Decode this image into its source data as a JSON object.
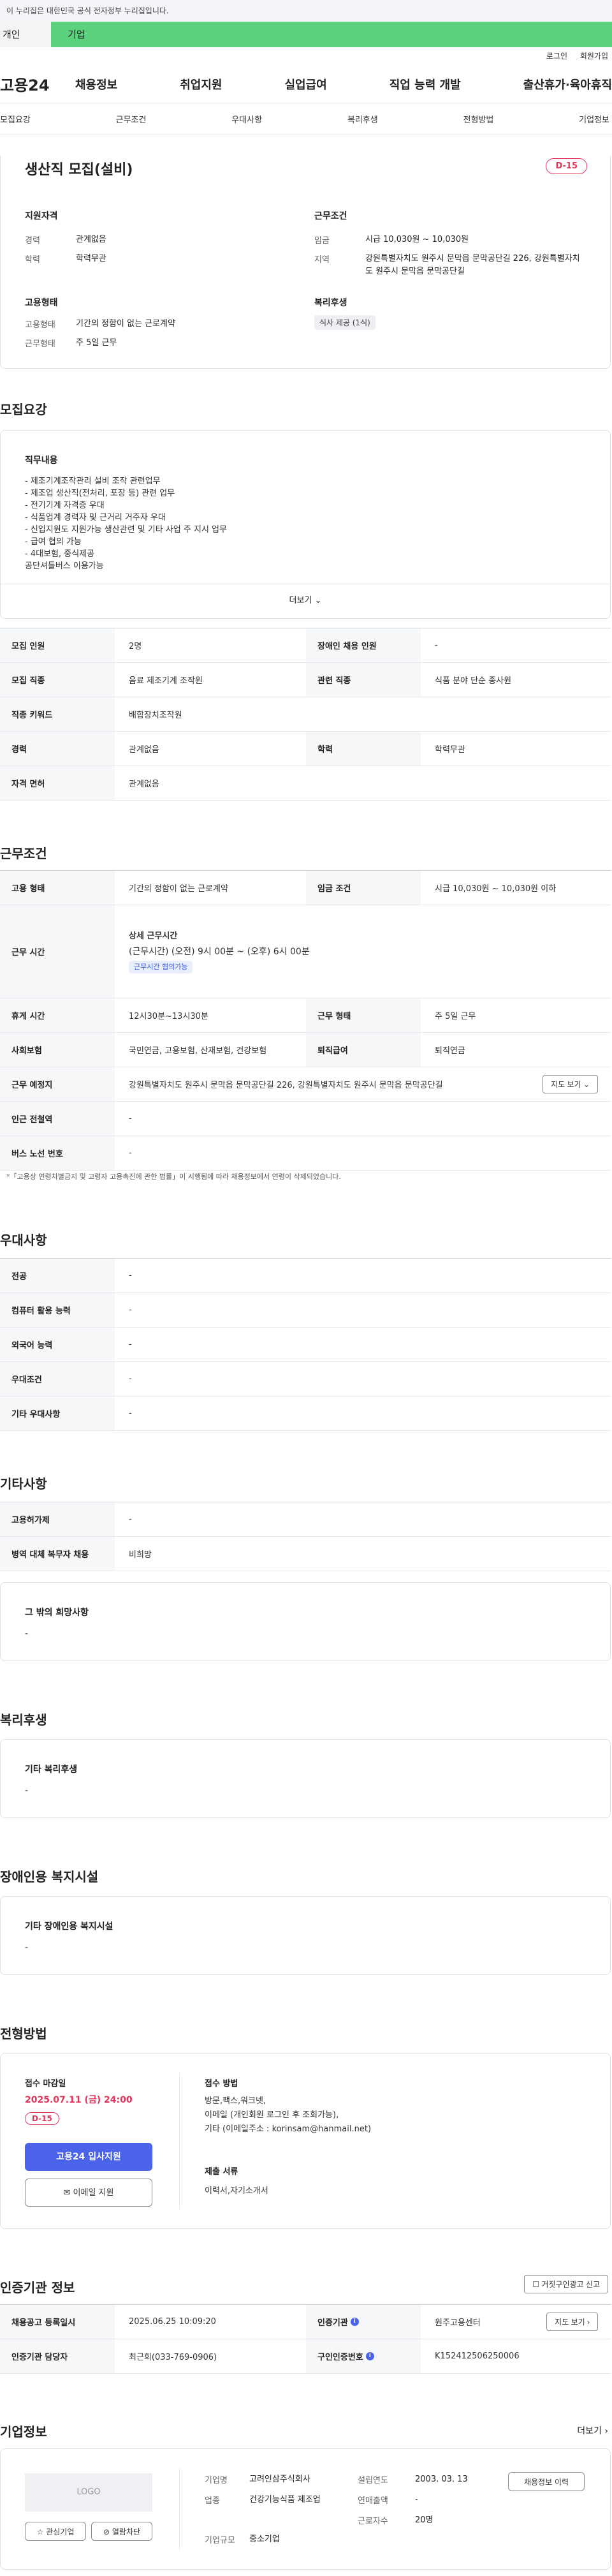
{
  "gov_banner": "이 누리집은 대한민국 공식 전자정부 누리집입니다.",
  "tabs": {
    "left": "개인",
    "right": "기업"
  },
  "util": {
    "login": "로그인",
    "join": "회원가입"
  },
  "logo": "고용24",
  "gnb": [
    "채용정보",
    "취업지원",
    "실업급여",
    "직업 능력 개발",
    "출산휴가·육아휴직"
  ],
  "anchors": [
    "모집요강",
    "근무조건",
    "우대사항",
    "복리후생",
    "전형방법",
    "기업정보"
  ],
  "job": {
    "title": "생산직 모집(설비)",
    "dday": "D-15",
    "qual_title": "지원자격",
    "qual": [
      {
        "k": "경력",
        "v": "관계없음"
      },
      {
        "k": "학력",
        "v": "학력무관"
      }
    ],
    "cond_title": "근무조건",
    "cond": [
      {
        "k": "임금",
        "v": "시급 10,030원 ~ 10,030원"
      },
      {
        "k": "지역",
        "v": "강원특별자치도 원주시 문막읍 문막공단길 226, 강원특별자치도 원주시 문막읍 문막공단길"
      }
    ],
    "emp_title": "고용형태",
    "emp": [
      {
        "k": "고용형태",
        "v": "기간의 정함이 없는 근로계약"
      },
      {
        "k": "근무형태",
        "v": "주 5일 근무"
      }
    ],
    "welfare_title": "복리후생",
    "welfare_chip": "식사 제공 (1식)"
  },
  "recruit": {
    "title": "모집요강",
    "duty_title": "직무내용",
    "duties": [
      "- 제조기계조작관리 설비 조작 관련업무",
      "- 제조업 생산직(전처리, 포장 등) 관련 업무",
      "- 전기기계 자격증 우대",
      "- 식품업계 경력자 및 근거리 거주자 우대",
      "- 신입지원도 지원가능 생산관련 및 기타 사업 주 지시 업무",
      "- 급여  협의 가능",
      "- 4대보험, 중식제공",
      "공단셔틀버스 이용가능"
    ],
    "more": "더보기",
    "rows": [
      {
        "a": "모집 인원",
        "b": "2명",
        "c": "장애인 채용 인원",
        "d": "-"
      },
      {
        "a": "모집 직종",
        "b": "음료 제조기계 조작원",
        "c": "관련 직종",
        "d": "식품 분야 단순 종사원"
      },
      {
        "a": "직종 키워드",
        "b": "배합장치조작원"
      },
      {
        "a": "경력",
        "b": "관계없음",
        "c": "학력",
        "d": "학력무관"
      },
      {
        "a": "자격 면허",
        "b": "관계없음"
      }
    ]
  },
  "work": {
    "title": "근무조건",
    "r1": {
      "a": "고용 형태",
      "b": "기간의 정함이 없는 근로계약",
      "c": "임금 조건",
      "d": "시급 10,030원 ~ 10,030원 이하"
    },
    "r2": {
      "a": "근무 시간",
      "sub": "상세 근무시간",
      "line": "(근무시간) (오전) 9시 00분 ~ (오후) 6시 00분",
      "chip": "근무시간 협의가능"
    },
    "r3": {
      "a": "휴게 시간",
      "b": "12시30분~13시30분",
      "c": "근무 형태",
      "d": "주 5일 근무"
    },
    "r4": {
      "a": "사회보험",
      "b": "국민연금, 고용보험, 산재보험, 건강보험",
      "c": "퇴직급여",
      "d": "퇴직연금"
    },
    "r5": {
      "a": "근무 예정지",
      "b": "강원특별자치도 원주시 문막읍 문막공단길 226, 강원특별자치도 원주시 문막읍 문막공단길",
      "btn": "지도 보기"
    },
    "r6": {
      "a": "인근 전철역",
      "b": "-"
    },
    "r7": {
      "a": "버스 노선 번호",
      "b": "-"
    },
    "note": "*「고용상 연령차별금지 및 고령자 고용촉진에 관한 법률」이 시행됨에 따라 채용정보에서 연령이 삭제되었습니다."
  },
  "pref": {
    "title": "우대사항",
    "rows": [
      {
        "a": "전공",
        "b": "-"
      },
      {
        "a": "컴퓨터 활용 능력",
        "b": "-"
      },
      {
        "a": "외국어 능력",
        "b": "-"
      },
      {
        "a": "우대조건",
        "b": "-"
      },
      {
        "a": "기타 우대사항",
        "b": "-"
      }
    ]
  },
  "etc": {
    "title": "기타사항",
    "rows": [
      {
        "a": "고용허가제",
        "b": "-"
      },
      {
        "a": "병역 대체 복무자 채용",
        "b": "비희망"
      }
    ],
    "box_t": "그 밖의 희망사항",
    "box_d": "-"
  },
  "welfare": {
    "title": "복리후생",
    "box_t": "기타 복리후생",
    "box_d": "-"
  },
  "disab": {
    "title": "장애인용 복지시설",
    "box_t": "기타 장애인용 복지시설",
    "box_d": "-"
  },
  "screen": {
    "title": "전형방법",
    "deadline_t": "접수 마감일",
    "deadline": "2025.07.11 (금) 24:00",
    "dday": "D-15",
    "apply": "고용24 입사지원",
    "email": "이메일 지원",
    "method_t": "접수 방법",
    "method": [
      "방문,팩스,워크넷,",
      "이메일 (개인회원 로그인 후 조회가능),",
      "기타 (이메일주소 : korinsam@hanmail.net)"
    ],
    "docs_t": "제출 서류",
    "docs": "이력서,자기소개서"
  },
  "cert": {
    "title": "인증기관 정보",
    "report": "거짓구인광고 신고",
    "r1": {
      "a": "채용공고 등록일시",
      "b": "2025.06.25 10:09:20",
      "c": "인증기관",
      "d": "원주고용센터",
      "btn": "지도 보기"
    },
    "r2": {
      "a": "인증기관 담당자",
      "b": "최근희(033-769-0906)",
      "c": "구인인증번호",
      "d": "K152412506250006"
    }
  },
  "company": {
    "title": "기업정보",
    "more": "더보기",
    "logo": "LOGO",
    "fav": "관심기업",
    "block": "열람차단",
    "f": [
      {
        "k": "기업명",
        "v": "고려인삼주식회사"
      },
      {
        "k": "업종",
        "v": "건강기능식품 제조업"
      },
      {
        "k": "기업규모",
        "v": "중소기업"
      }
    ],
    "g": [
      {
        "k": "설립연도",
        "v": "2003. 03. 13"
      },
      {
        "k": "연매출액",
        "v": "-"
      },
      {
        "k": "근로자수",
        "v": "20명"
      }
    ],
    "btn": "채용정보 이력"
  },
  "colors": {
    "accent": "#4a63e8",
    "green": "#5dd27e",
    "red": "#e0355a"
  }
}
